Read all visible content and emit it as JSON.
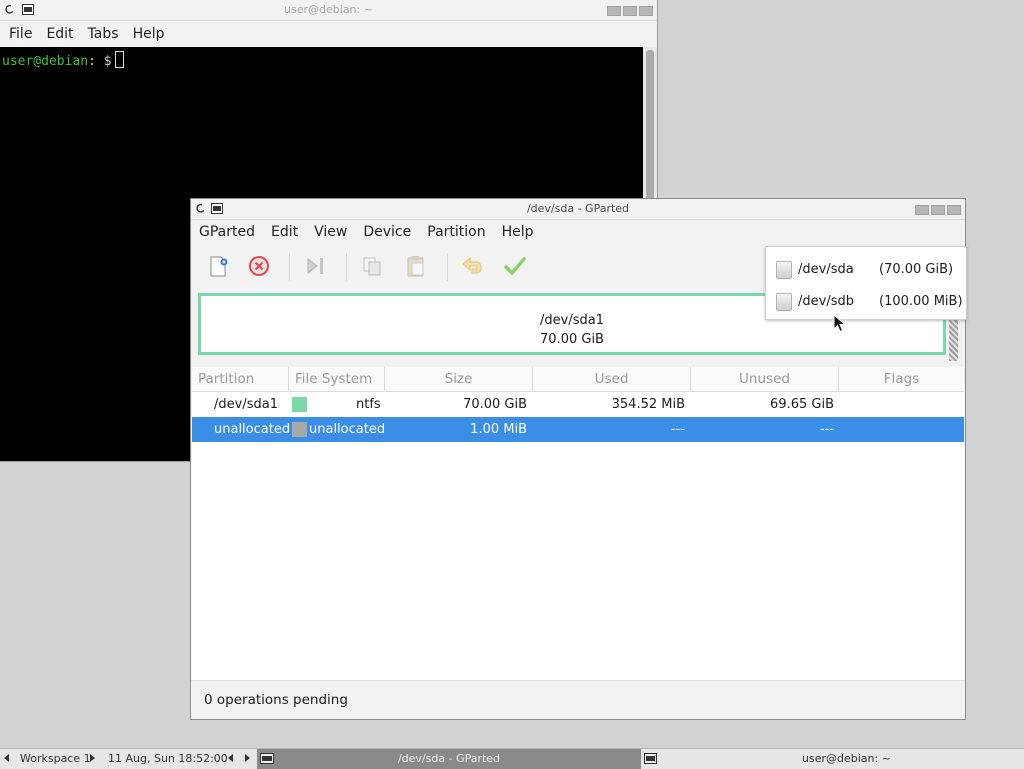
{
  "terminal": {
    "title": "user@debian: ~",
    "menu": [
      "File",
      "Edit",
      "Tabs",
      "Help"
    ],
    "prompt_user": "user@debian",
    "prompt_rest": ": $"
  },
  "gparted": {
    "title": "/dev/sda - GParted",
    "menu": [
      "GParted",
      "Edit",
      "View",
      "Device",
      "Partition",
      "Help"
    ],
    "toolbar": [
      "new-icon",
      "delete-icon",
      "resize-move-icon",
      "copy-icon",
      "paste-icon",
      "undo-icon",
      "apply-icon"
    ],
    "device_menu": [
      {
        "name": "/dev/sda",
        "size": "(70.00 GiB)"
      },
      {
        "name": "/dev/sdb",
        "size": "(100.00 MiB)"
      }
    ],
    "map": {
      "name": "/dev/sda1",
      "size": "70.00 GiB"
    },
    "columns": [
      "Partition",
      "File System",
      "Size",
      "Used",
      "Unused",
      "Flags"
    ],
    "rows": [
      {
        "partition": "/dev/sda1",
        "fs": "ntfs",
        "fs_color": "#7bd9a9",
        "size": "70.00 GiB",
        "used": "354.52 MiB",
        "unused": "69.65 GiB",
        "flags": ""
      },
      {
        "partition": "unallocated",
        "fs": "unallocated",
        "fs_color": "#a8a8a8",
        "size": "1.00 MiB",
        "used": "---",
        "unused": "---",
        "flags": "",
        "selected": true
      }
    ],
    "status": "0 operations pending"
  },
  "taskbar": {
    "workspace": "Workspace 1",
    "clock": "11 Aug, Sun 18:52:00",
    "tasks": [
      "/dev/sda - GParted",
      "user@debian: ~"
    ]
  },
  "colors": {
    "accent": "#3a8ee6",
    "ntfs": "#7bd9a9",
    "terminal_green": "#3fbf3f"
  }
}
